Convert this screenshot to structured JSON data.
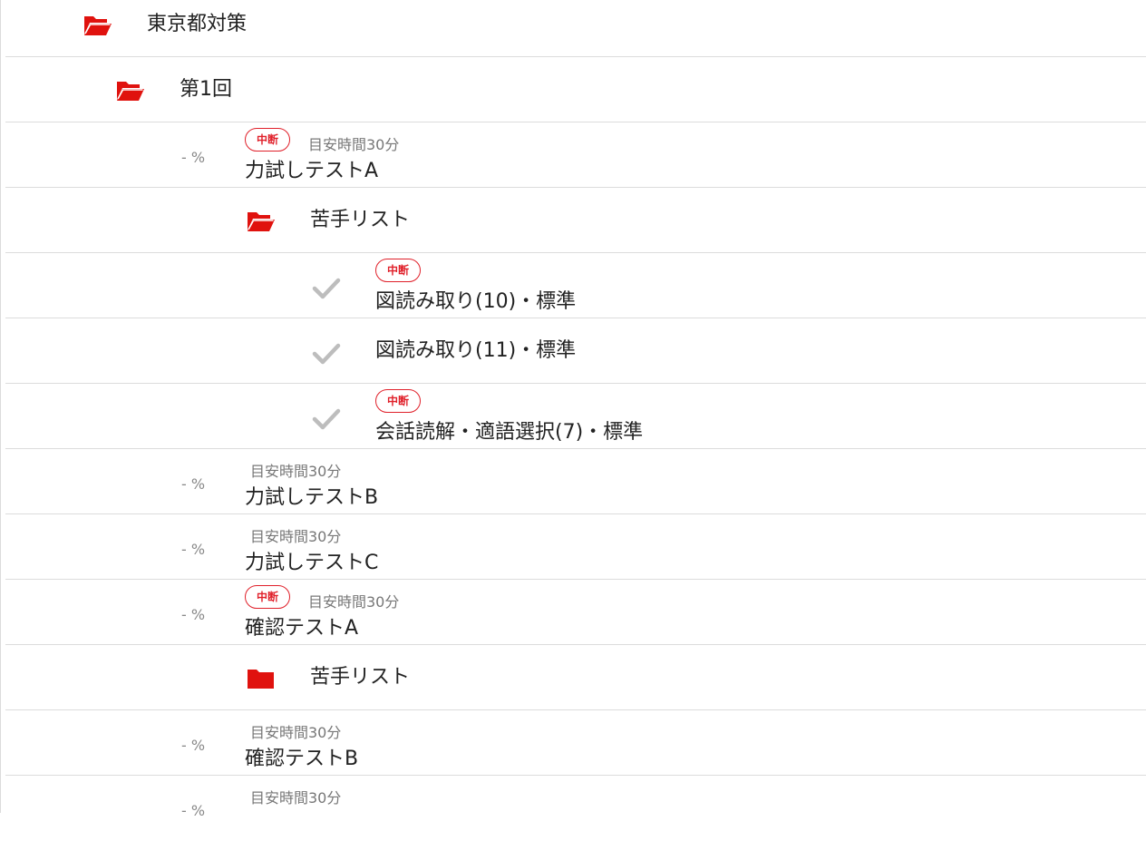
{
  "tree": {
    "root_folder": {
      "label": "東京都対策",
      "icon": "folder-open-icon"
    },
    "session_folder": {
      "label": "第1回",
      "icon": "folder-open-icon"
    },
    "tests": [
      {
        "progress": "- %",
        "badge": "中断",
        "meta": "目安時間30分",
        "title": "力試しテストA"
      },
      {
        "progress": "- %",
        "badge": "",
        "meta": "目安時間30分",
        "title": "力試しテストB"
      },
      {
        "progress": "- %",
        "badge": "",
        "meta": "目安時間30分",
        "title": "力試しテストC"
      },
      {
        "progress": "- %",
        "badge": "中断",
        "meta": "目安時間30分",
        "title": "確認テストA"
      },
      {
        "progress": "- %",
        "badge": "",
        "meta": "目安時間30分",
        "title": "確認テストB"
      },
      {
        "progress": "- %",
        "badge": "",
        "meta": "目安時間30分",
        "title": ""
      }
    ],
    "weak_list_1": {
      "label": "苦手リスト",
      "icon": "folder-open-icon",
      "items": [
        {
          "badge": "中断",
          "title": "図読み取り(10)・標準",
          "icon": "checkmark-icon"
        },
        {
          "badge": "",
          "title": "図読み取り(11)・標準",
          "icon": "checkmark-icon"
        },
        {
          "badge": "中断",
          "title": "会話読解・適語選択(7)・標準",
          "icon": "checkmark-icon"
        }
      ]
    },
    "weak_list_2": {
      "label": "苦手リスト",
      "icon": "folder-closed-icon"
    }
  },
  "colors": {
    "accent": "#e0202a",
    "folder": "#e0120e",
    "check": "#bdbdbd",
    "divider": "#dcdcdc",
    "muted": "#777777"
  }
}
